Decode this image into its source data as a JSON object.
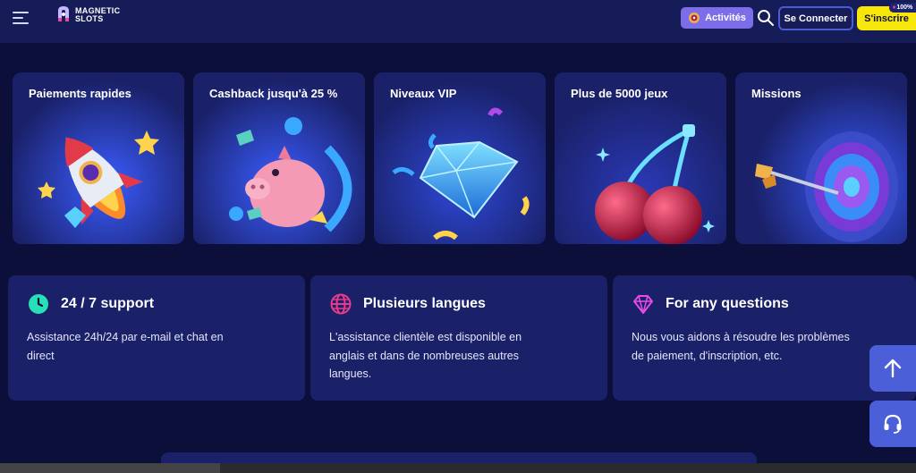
{
  "header": {
    "logo_line1": "MAGNETIC",
    "logo_line2": "SLOTS",
    "activities_label": "Activités",
    "login_label": "Se Connecter",
    "signup_label": "S'inscrire",
    "bonus_badge": "100%"
  },
  "features": [
    {
      "title": "Paiements rapides",
      "icon": "rocket-icon"
    },
    {
      "title": "Cashback jusqu'à 25 %",
      "icon": "piggy-bank-icon"
    },
    {
      "title": "Niveaux VIP",
      "icon": "diamond-icon"
    },
    {
      "title": "Plus de 5000 jeux",
      "icon": "cherries-icon"
    },
    {
      "title": "Missions",
      "icon": "target-icon"
    }
  ],
  "info_cards": [
    {
      "title": "24 / 7 support",
      "text_line1": "Assistance 24h/24 par e-mail et chat en",
      "text_line2": "direct",
      "text_line3": "",
      "icon": "clock-icon"
    },
    {
      "title": "Plusieurs langues",
      "text_line1": "L'assistance clientèle est disponible en",
      "text_line2": "anglais et dans de nombreuses autres",
      "text_line3": "langues.",
      "icon": "globe-icon"
    },
    {
      "title": "For any questions",
      "text_line1": "Nous vous aidons à résoudre les problèmes",
      "text_line2": "de paiement, d'inscription, etc.",
      "text_line3": "",
      "icon": "diamond-outline-icon"
    }
  ],
  "floating": {
    "scroll_top_icon": "arrow-up-icon",
    "support_icon": "headset-icon"
  },
  "colors": {
    "background": "#0b0f3a",
    "card": "#1a2169",
    "accent": "#4b5fd8",
    "signup": "#f6e60a",
    "activities": "#7c6ee8"
  }
}
